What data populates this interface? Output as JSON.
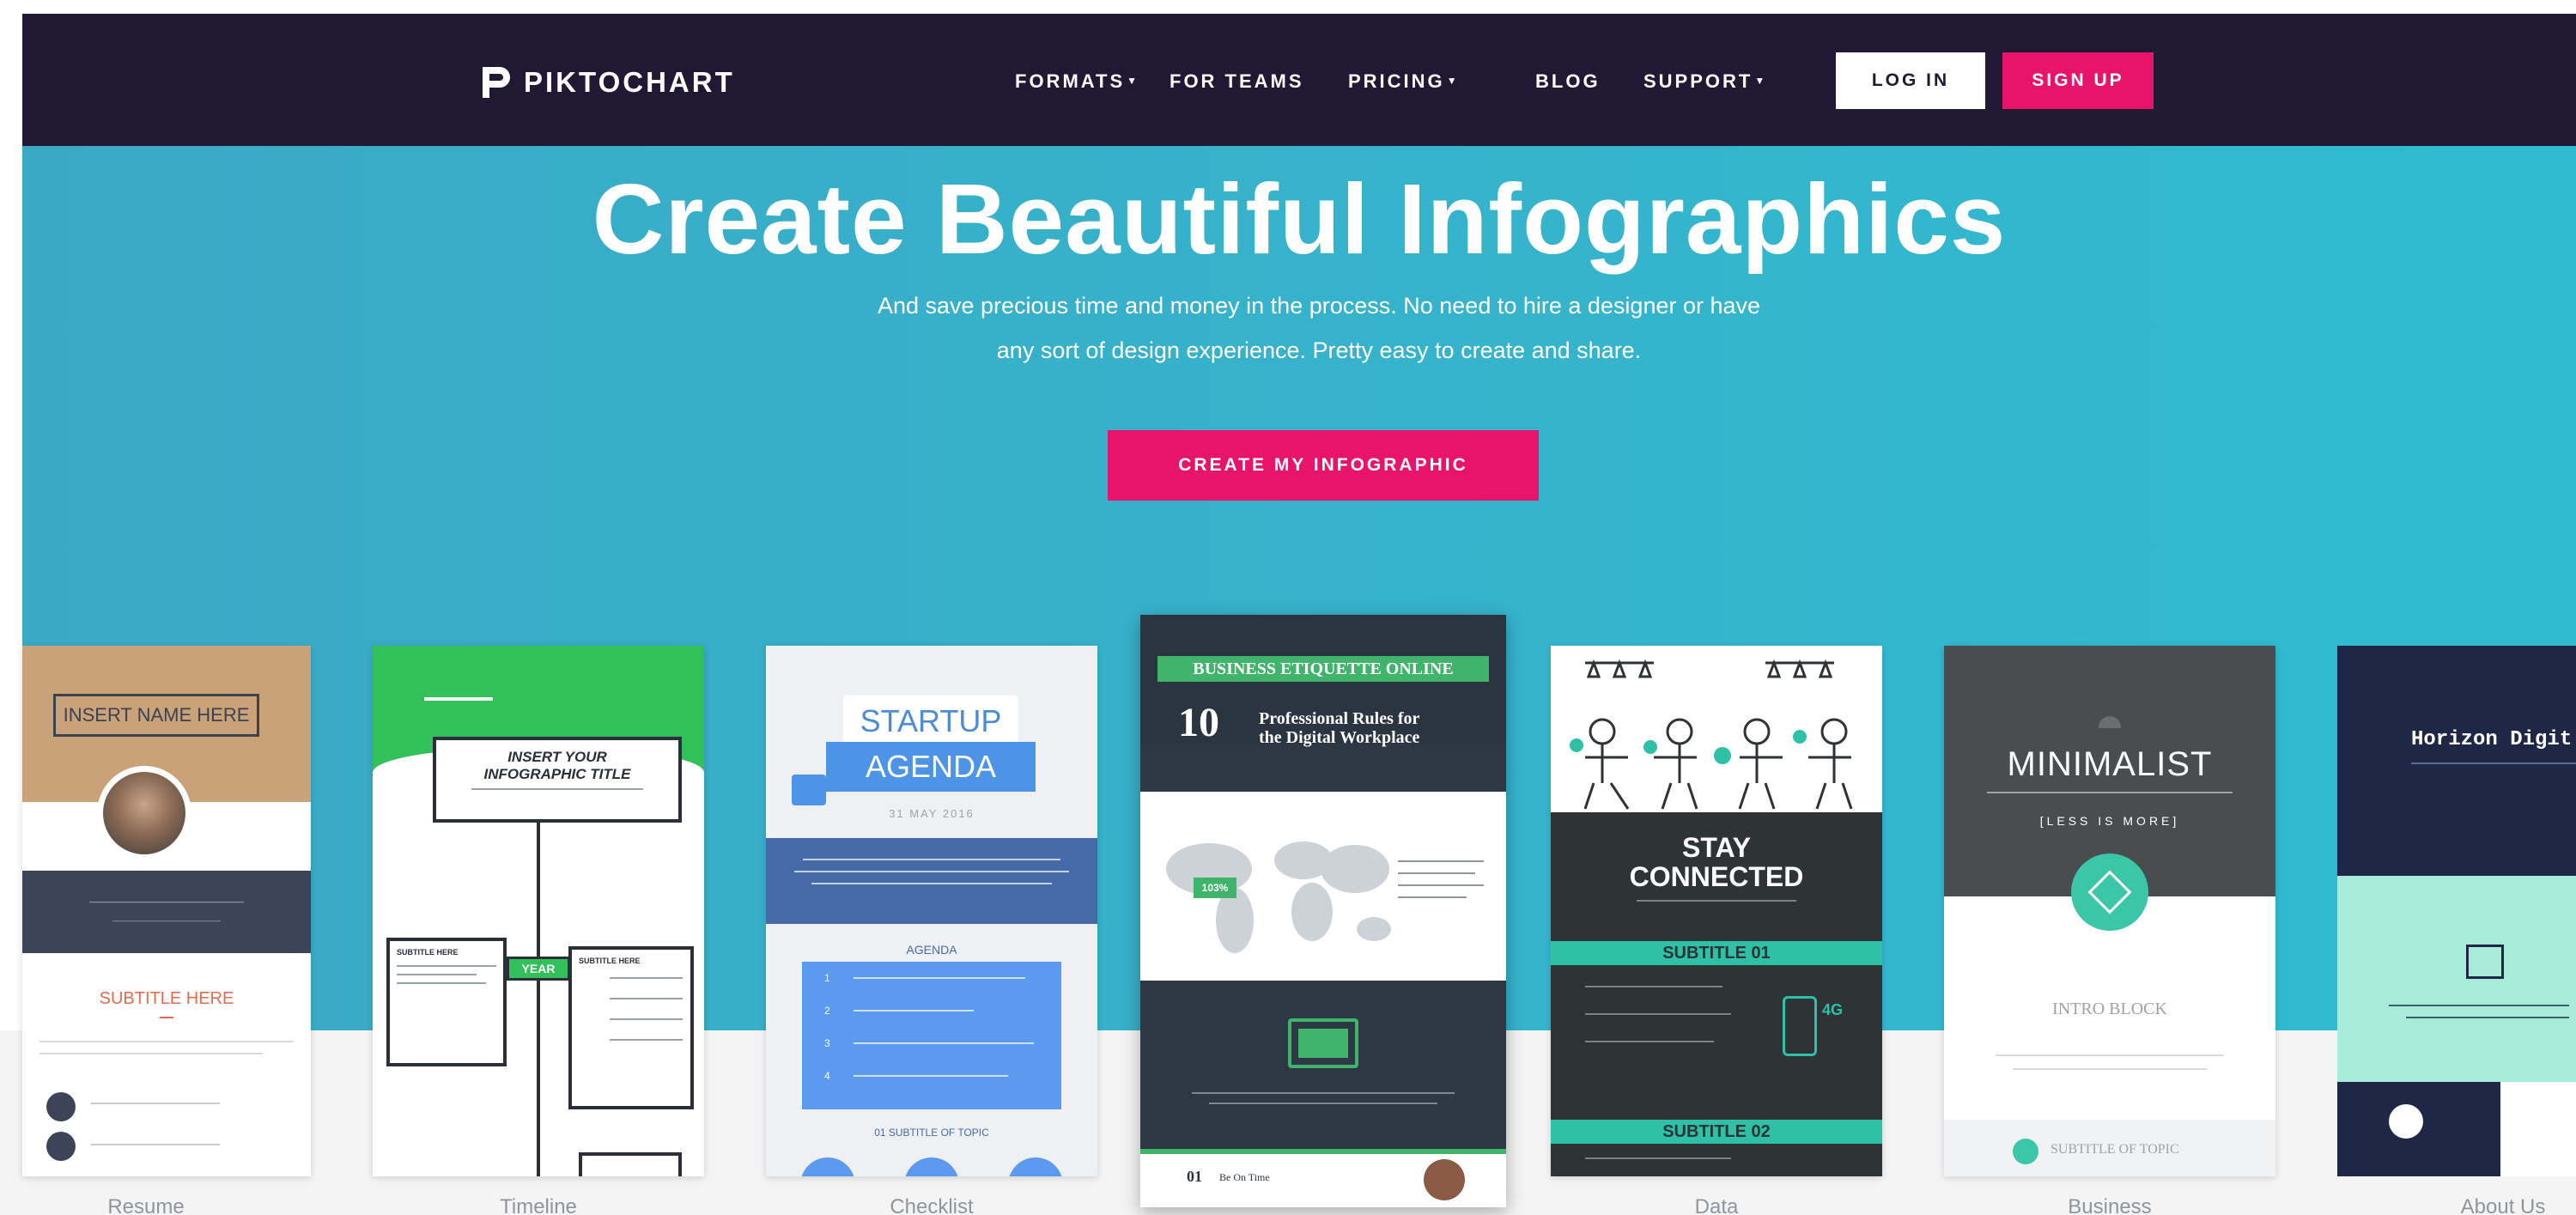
{
  "nav": {
    "logo_text": "PIKTOCHART",
    "links": [
      {
        "label": "FORMATS",
        "has_caret": true
      },
      {
        "label": "FOR TEAMS",
        "has_caret": false
      },
      {
        "label": "PRICING",
        "has_caret": true
      },
      {
        "label": "BLOG",
        "has_caret": false
      },
      {
        "label": "SUPPORT",
        "has_caret": true
      }
    ],
    "login_label": "LOG IN",
    "signup_label": "SIGN UP"
  },
  "hero": {
    "title": "Create Beautiful Infographics",
    "subtitle_line1": "And save precious time and money in the process. No need to hire a designer or have",
    "subtitle_line2": "any sort of design experience. Pretty easy to create and share.",
    "cta_label": "CREATE MY INFOGRAPHIC"
  },
  "templates": {
    "resume": {
      "label": "Resume",
      "name": "INSERT NAME HERE",
      "subtitle": "SUBTITLE HERE"
    },
    "timeline": {
      "label": "Timeline",
      "title_line1": "INSERT YOUR",
      "title_line2": "INFOGRAPHIC TITLE",
      "subtitle_here": "SUBTITLE HERE",
      "year": "YEAR"
    },
    "checklist": {
      "label": "Checklist",
      "title_line1": "STARTUP",
      "title_line2": "AGENDA",
      "date": "31 MAY 2016",
      "agenda": "AGENDA",
      "items": [
        "1",
        "2",
        "3",
        "4"
      ],
      "subtitle": "01  SUBTITLE OF TOPIC"
    },
    "featured": {
      "banner": "BUSINESS ETIQUETTE ONLINE",
      "number": "10",
      "title_line1": "Professional Rules for",
      "title_line2": "the Digital Workplace",
      "percent": "103%",
      "footer_num": "01",
      "footer_text": "Be On Time"
    },
    "data": {
      "label": "Data",
      "title_line1": "STAY",
      "title_line2": "CONNECTED",
      "subtitle1": "SUBTITLE 01",
      "subtitle2": "SUBTITLE 02",
      "signal": "4G"
    },
    "business": {
      "label": "Business",
      "title": "MINIMALIST",
      "tagline": "[LESS IS MORE]",
      "block": "INTRO BLOCK",
      "subtitle": "SUBTITLE OF TOPIC"
    },
    "about": {
      "label": "About Us",
      "title": "Horizon Digit"
    }
  },
  "colors": {
    "nav_bg": "#211933",
    "hero_bg": "#36b3cc",
    "accent_pink": "#e8146b",
    "label_gray": "#8e959c"
  }
}
